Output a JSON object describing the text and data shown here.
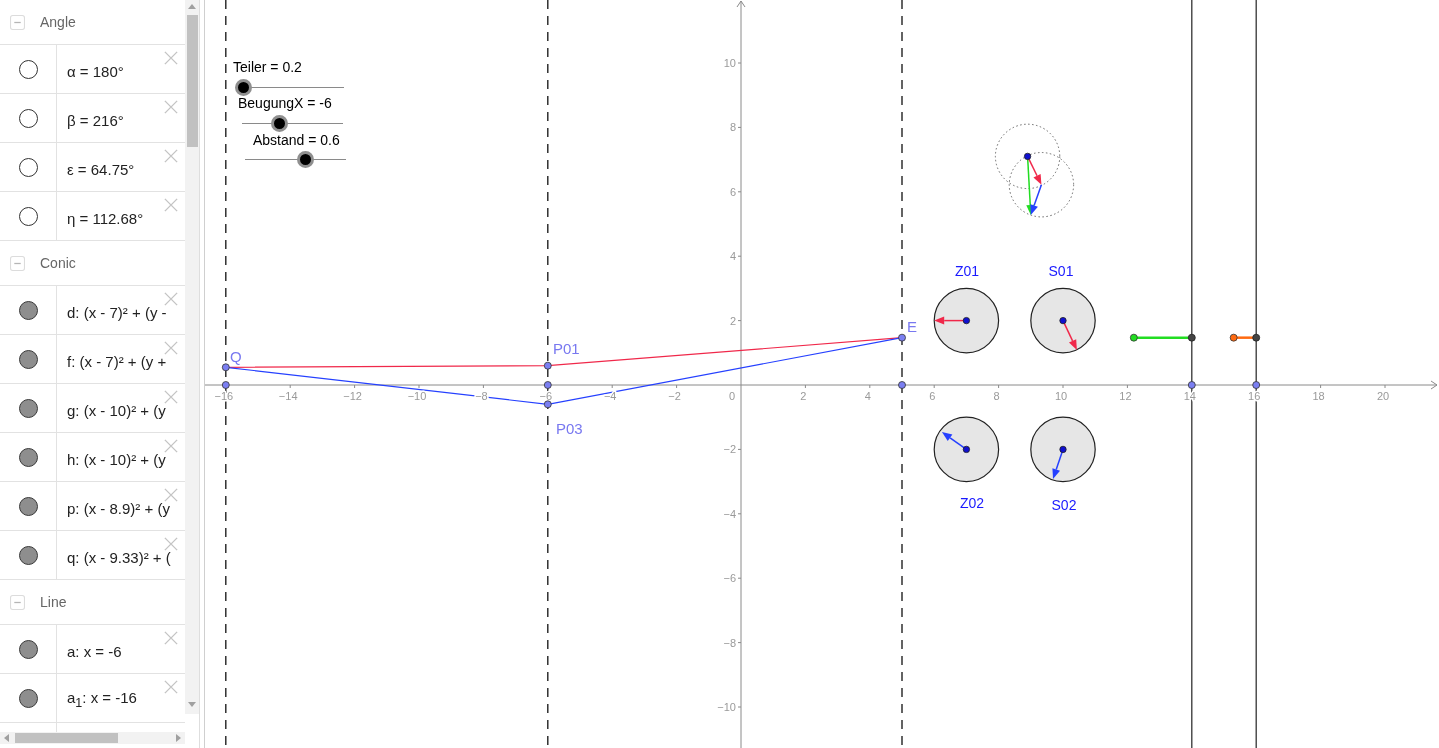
{
  "algebra_view": {
    "groups": [
      {
        "title": "Angle",
        "expanded": true,
        "items": [
          {
            "text": "α = 180°",
            "visible": false
          },
          {
            "text": "β = 216°",
            "visible": false
          },
          {
            "text": "ε = 64.75°",
            "visible": false
          },
          {
            "text": "η = 112.68°",
            "visible": false
          }
        ]
      },
      {
        "title": "Conic",
        "expanded": true,
        "items": [
          {
            "text": "d: (x - 7)² + (y -",
            "visible": true
          },
          {
            "text": "f: (x - 7)² + (y +",
            "visible": true
          },
          {
            "text": "g: (x - 10)² + (y",
            "visible": true
          },
          {
            "text": "h: (x - 10)² + (y",
            "visible": true
          },
          {
            "text": "p: (x - 8.9)² + (y",
            "visible": true
          },
          {
            "text": "q: (x - 9.33)² + (",
            "visible": true
          }
        ]
      },
      {
        "title": "Line",
        "expanded": true,
        "items": [
          {
            "text": "a: x = -6",
            "visible": true
          },
          {
            "text": "a$_{1}$: x = -16",
            "visible": true
          }
        ]
      }
    ]
  },
  "graphics_view": {
    "sliders": [
      {
        "label": "Teiler = 0.2",
        "level": 0.07
      },
      {
        "label": "BeugungX = -6",
        "level": 0.37
      },
      {
        "label": "Abstand = 0.6",
        "level": 0.6
      }
    ],
    "x_axis_labels": [
      "−16",
      "−14",
      "−12",
      "−10",
      "−8",
      "−6",
      "−4",
      "−2",
      "0",
      "2",
      "4",
      "6",
      "8",
      "10",
      "12",
      "14",
      "16",
      "18",
      "20"
    ],
    "y_axis_labels": [
      "10",
      "8",
      "6",
      "4",
      "2",
      "−2",
      "−4",
      "−6",
      "−8",
      "−10"
    ],
    "point_labels": [
      "Q",
      "P01",
      "E",
      "P03"
    ],
    "dial_labels": [
      "Z01",
      "S01",
      "Z02",
      "S02"
    ]
  }
}
